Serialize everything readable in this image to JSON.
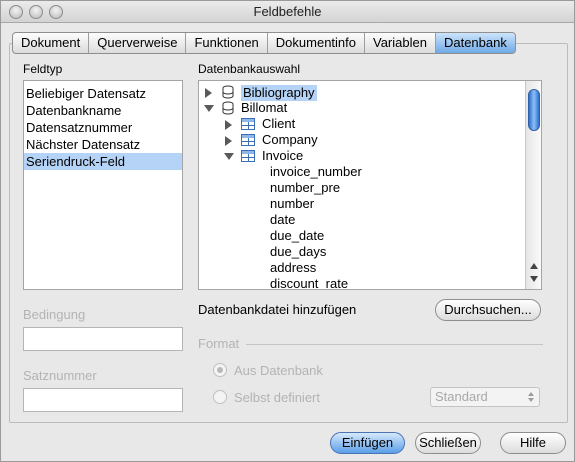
{
  "window": {
    "title": "Feldbefehle"
  },
  "tabs": [
    {
      "label": "Dokument"
    },
    {
      "label": "Querverweise"
    },
    {
      "label": "Funktionen"
    },
    {
      "label": "Dokumentinfo"
    },
    {
      "label": "Variablen"
    },
    {
      "label": "Datenbank",
      "active": true
    }
  ],
  "feldtyp": {
    "label": "Feldtyp",
    "items": [
      "Beliebiger Datensatz",
      "Datenbankname",
      "Datensatznummer",
      "Nächster Datensatz",
      "Seriendruck-Feld"
    ],
    "selected_index": 4
  },
  "datenbankauswahl": {
    "label": "Datenbankauswahl",
    "tree": [
      {
        "label": "Bibliography",
        "type": "database",
        "expanded": false
      },
      {
        "label": "Billomat",
        "type": "database",
        "expanded": true
      },
      {
        "label": "Client",
        "type": "table",
        "expanded": false
      },
      {
        "label": "Company",
        "type": "table",
        "expanded": false
      },
      {
        "label": "Invoice",
        "type": "table",
        "expanded": true
      },
      {
        "label": "invoice_number",
        "type": "field"
      },
      {
        "label": "number_pre",
        "type": "field"
      },
      {
        "label": "number",
        "type": "field"
      },
      {
        "label": "date",
        "type": "field"
      },
      {
        "label": "due_date",
        "type": "field"
      },
      {
        "label": "due_days",
        "type": "field"
      },
      {
        "label": "address",
        "type": "field"
      },
      {
        "label": "discount_rate",
        "type": "field"
      }
    ]
  },
  "add_db": {
    "label": "Datenbankdatei hinzufügen",
    "button": "Durchsuchen..."
  },
  "bedingung": {
    "label": "Bedingung",
    "value": ""
  },
  "satznummer": {
    "label": "Satznummer",
    "value": ""
  },
  "format": {
    "label": "Format",
    "radio_from_db": "Aus Datenbank",
    "radio_custom": "Selbst definiert",
    "select_value": "Standard"
  },
  "footer": {
    "insert": "Einfügen",
    "close": "Schließen",
    "help": "Hilfe"
  },
  "colors": {
    "accent": "#5a9ee8",
    "selection": "#b5d3f6",
    "scroll_thumb": "#2e6fd0"
  }
}
